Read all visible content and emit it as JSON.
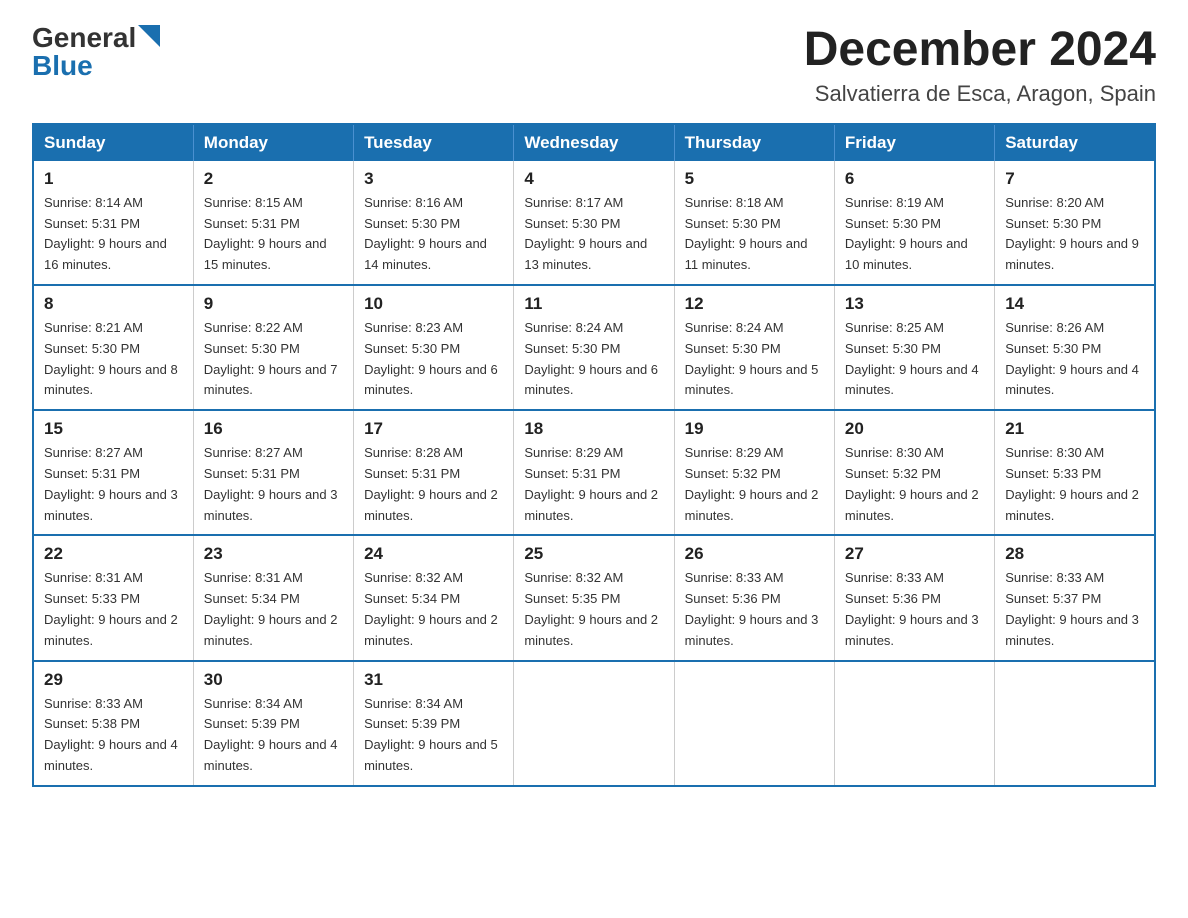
{
  "header": {
    "logo_general": "General",
    "logo_blue": "Blue",
    "month_title": "December 2024",
    "subtitle": "Salvatierra de Esca, Aragon, Spain"
  },
  "weekdays": [
    "Sunday",
    "Monday",
    "Tuesday",
    "Wednesday",
    "Thursday",
    "Friday",
    "Saturday"
  ],
  "weeks": [
    [
      {
        "day": "1",
        "sunrise": "8:14 AM",
        "sunset": "5:31 PM",
        "daylight": "9 hours and 16 minutes."
      },
      {
        "day": "2",
        "sunrise": "8:15 AM",
        "sunset": "5:31 PM",
        "daylight": "9 hours and 15 minutes."
      },
      {
        "day": "3",
        "sunrise": "8:16 AM",
        "sunset": "5:30 PM",
        "daylight": "9 hours and 14 minutes."
      },
      {
        "day": "4",
        "sunrise": "8:17 AM",
        "sunset": "5:30 PM",
        "daylight": "9 hours and 13 minutes."
      },
      {
        "day": "5",
        "sunrise": "8:18 AM",
        "sunset": "5:30 PM",
        "daylight": "9 hours and 11 minutes."
      },
      {
        "day": "6",
        "sunrise": "8:19 AM",
        "sunset": "5:30 PM",
        "daylight": "9 hours and 10 minutes."
      },
      {
        "day": "7",
        "sunrise": "8:20 AM",
        "sunset": "5:30 PM",
        "daylight": "9 hours and 9 minutes."
      }
    ],
    [
      {
        "day": "8",
        "sunrise": "8:21 AM",
        "sunset": "5:30 PM",
        "daylight": "9 hours and 8 minutes."
      },
      {
        "day": "9",
        "sunrise": "8:22 AM",
        "sunset": "5:30 PM",
        "daylight": "9 hours and 7 minutes."
      },
      {
        "day": "10",
        "sunrise": "8:23 AM",
        "sunset": "5:30 PM",
        "daylight": "9 hours and 6 minutes."
      },
      {
        "day": "11",
        "sunrise": "8:24 AM",
        "sunset": "5:30 PM",
        "daylight": "9 hours and 6 minutes."
      },
      {
        "day": "12",
        "sunrise": "8:24 AM",
        "sunset": "5:30 PM",
        "daylight": "9 hours and 5 minutes."
      },
      {
        "day": "13",
        "sunrise": "8:25 AM",
        "sunset": "5:30 PM",
        "daylight": "9 hours and 4 minutes."
      },
      {
        "day": "14",
        "sunrise": "8:26 AM",
        "sunset": "5:30 PM",
        "daylight": "9 hours and 4 minutes."
      }
    ],
    [
      {
        "day": "15",
        "sunrise": "8:27 AM",
        "sunset": "5:31 PM",
        "daylight": "9 hours and 3 minutes."
      },
      {
        "day": "16",
        "sunrise": "8:27 AM",
        "sunset": "5:31 PM",
        "daylight": "9 hours and 3 minutes."
      },
      {
        "day": "17",
        "sunrise": "8:28 AM",
        "sunset": "5:31 PM",
        "daylight": "9 hours and 2 minutes."
      },
      {
        "day": "18",
        "sunrise": "8:29 AM",
        "sunset": "5:31 PM",
        "daylight": "9 hours and 2 minutes."
      },
      {
        "day": "19",
        "sunrise": "8:29 AM",
        "sunset": "5:32 PM",
        "daylight": "9 hours and 2 minutes."
      },
      {
        "day": "20",
        "sunrise": "8:30 AM",
        "sunset": "5:32 PM",
        "daylight": "9 hours and 2 minutes."
      },
      {
        "day": "21",
        "sunrise": "8:30 AM",
        "sunset": "5:33 PM",
        "daylight": "9 hours and 2 minutes."
      }
    ],
    [
      {
        "day": "22",
        "sunrise": "8:31 AM",
        "sunset": "5:33 PM",
        "daylight": "9 hours and 2 minutes."
      },
      {
        "day": "23",
        "sunrise": "8:31 AM",
        "sunset": "5:34 PM",
        "daylight": "9 hours and 2 minutes."
      },
      {
        "day": "24",
        "sunrise": "8:32 AM",
        "sunset": "5:34 PM",
        "daylight": "9 hours and 2 minutes."
      },
      {
        "day": "25",
        "sunrise": "8:32 AM",
        "sunset": "5:35 PM",
        "daylight": "9 hours and 2 minutes."
      },
      {
        "day": "26",
        "sunrise": "8:33 AM",
        "sunset": "5:36 PM",
        "daylight": "9 hours and 3 minutes."
      },
      {
        "day": "27",
        "sunrise": "8:33 AM",
        "sunset": "5:36 PM",
        "daylight": "9 hours and 3 minutes."
      },
      {
        "day": "28",
        "sunrise": "8:33 AM",
        "sunset": "5:37 PM",
        "daylight": "9 hours and 3 minutes."
      }
    ],
    [
      {
        "day": "29",
        "sunrise": "8:33 AM",
        "sunset": "5:38 PM",
        "daylight": "9 hours and 4 minutes."
      },
      {
        "day": "30",
        "sunrise": "8:34 AM",
        "sunset": "5:39 PM",
        "daylight": "9 hours and 4 minutes."
      },
      {
        "day": "31",
        "sunrise": "8:34 AM",
        "sunset": "5:39 PM",
        "daylight": "9 hours and 5 minutes."
      },
      null,
      null,
      null,
      null
    ]
  ]
}
